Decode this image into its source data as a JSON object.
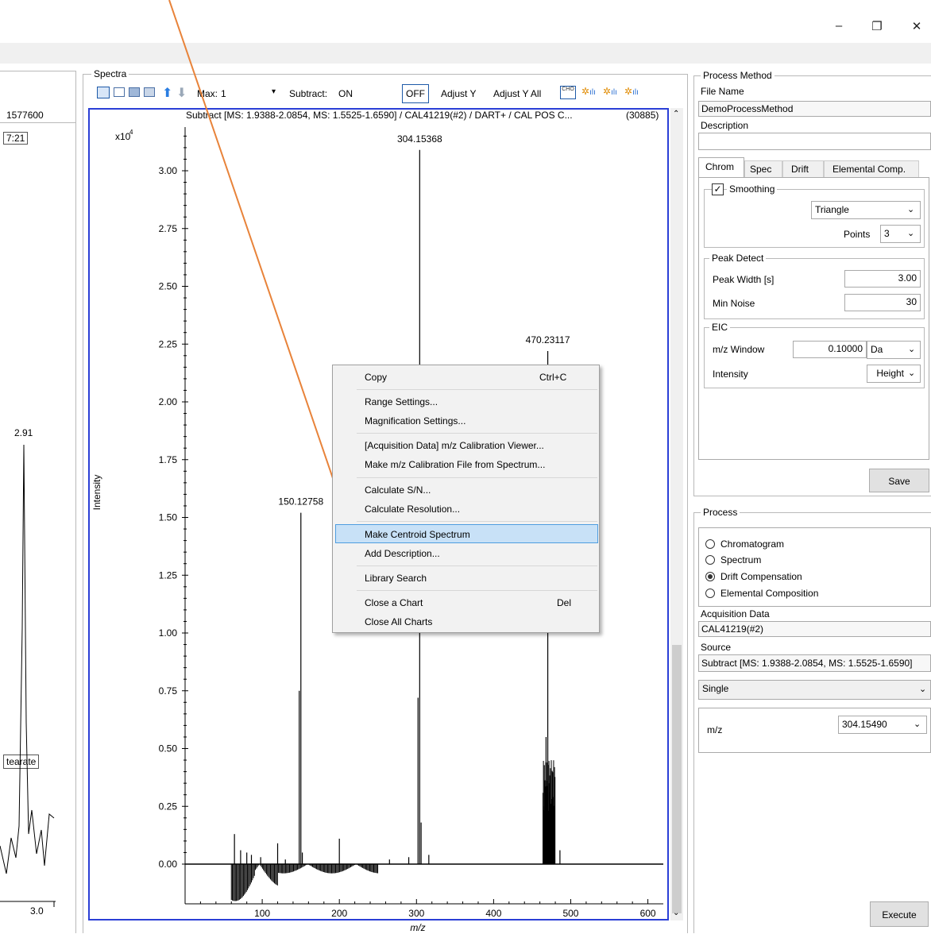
{
  "window": {
    "min": "–",
    "restore": "❐",
    "close": "✕"
  },
  "left": {
    "label_top": "1577600",
    "label_box": "7:21",
    "peak": "2.91",
    "stearate": "tearate",
    "x_tick": "3.0"
  },
  "spectra": {
    "title": "Spectra",
    "toolbar": {
      "max_label": "Max:",
      "max_value": "1",
      "subtract_label": "Subtract:",
      "on": "ON",
      "off": "OFF",
      "adjust_y": "Adjust Y",
      "adjust_y_all": "Adjust Y All"
    },
    "header": "Subtract [MS: 1.9388-2.0854, MS: 1.5525-1.6590] / CAL41219(#2) / DART+ / CAL POS C...",
    "count": "(30885)"
  },
  "chart_data": {
    "type": "line",
    "xlabel": "m/z",
    "ylabel": "Intensity",
    "y_exponent": "x10",
    "y_exponent_power": "4",
    "xlim": [
      0,
      620
    ],
    "ylim": [
      -0.12,
      3.26
    ],
    "x_ticks": [
      "100",
      "200",
      "300",
      "400",
      "500",
      "600"
    ],
    "x_tick_values": [
      100,
      200,
      300,
      400,
      500,
      600
    ],
    "y_ticks": [
      "3.00",
      "2.75",
      "2.50",
      "2.25",
      "2.00",
      "1.75",
      "1.50",
      "1.25",
      "1.00",
      "0.75",
      "0.50",
      "0.25",
      "0.00"
    ],
    "y_tick_values": [
      3.0,
      2.75,
      2.5,
      2.25,
      2.0,
      1.75,
      1.5,
      1.25,
      1.0,
      0.75,
      0.5,
      0.25,
      0.0
    ],
    "peaks": [
      {
        "mz": 64,
        "intensity": 0.13
      },
      {
        "mz": 72,
        "intensity": 0.06
      },
      {
        "mz": 80,
        "intensity": 0.05
      },
      {
        "mz": 86,
        "intensity": 0.04
      },
      {
        "mz": 98,
        "intensity": 0.03
      },
      {
        "mz": 120,
        "intensity": 0.09
      },
      {
        "mz": 130,
        "intensity": 0.02
      },
      {
        "mz": 148,
        "intensity": 0.75
      },
      {
        "mz": 150.12758,
        "intensity": 1.52
      },
      {
        "mz": 152,
        "intensity": 0.05
      },
      {
        "mz": 200,
        "intensity": 0.11
      },
      {
        "mz": 265,
        "intensity": 0.02
      },
      {
        "mz": 290,
        "intensity": 0.03
      },
      {
        "mz": 302,
        "intensity": 0.72
      },
      {
        "mz": 304.15368,
        "intensity": 3.09
      },
      {
        "mz": 306,
        "intensity": 0.18
      },
      {
        "mz": 316,
        "intensity": 0.04
      },
      {
        "mz": 466,
        "intensity": 0.25
      },
      {
        "mz": 468,
        "intensity": 0.55
      },
      {
        "mz": 470.23117,
        "intensity": 2.22
      },
      {
        "mz": 472,
        "intensity": 0.35
      },
      {
        "mz": 474,
        "intensity": 0.12
      },
      {
        "mz": 486,
        "intensity": 0.06
      }
    ],
    "labels": [
      {
        "mz": 304.15368,
        "text": "304.15368"
      },
      {
        "mz": 150.12758,
        "text": "150.12758"
      },
      {
        "mz": 470.23117,
        "text": "470.23117"
      }
    ]
  },
  "context_menu": {
    "items": [
      {
        "label": "Copy",
        "shortcut": "Ctrl+C"
      },
      {
        "label": "Range Settings..."
      },
      {
        "label": "Magnification Settings..."
      },
      {
        "label": "[Acquisition Data] m/z Calibration Viewer..."
      },
      {
        "label": "Make m/z Calibration File from Spectrum..."
      },
      {
        "label": "Calculate S/N..."
      },
      {
        "label": "Calculate Resolution..."
      },
      {
        "label": "Make Centroid Spectrum"
      },
      {
        "label": "Add Description..."
      },
      {
        "label": "Library Search"
      },
      {
        "label": "Close a Chart",
        "shortcut": "Del"
      },
      {
        "label": "Close All Charts"
      }
    ]
  },
  "process_method": {
    "title": "Process Method",
    "file_name_label": "File Name",
    "file_name": "DemoProcessMethod",
    "description_label": "Description",
    "description": "",
    "tabs": [
      "Chrom",
      "Spec",
      "Drift",
      "Elemental Comp."
    ],
    "smoothing_label": "Smoothing",
    "smoothing_type": "Triangle",
    "points_label": "Points",
    "points": "3",
    "peak_detect": "Peak Detect",
    "peak_width_label": "Peak Width [s]",
    "peak_width": "3.00",
    "min_noise_label": "Min Noise",
    "min_noise": "30",
    "eic": "EIC",
    "mz_window_label": "m/z Window",
    "mz_window": "0.10000",
    "mz_unit": "Da",
    "intensity_label": "Intensity",
    "intensity": "Height",
    "save": "Save"
  },
  "process": {
    "title": "Process",
    "options": [
      "Chromatogram",
      "Spectrum",
      "Drift Compensation",
      "Elemental Composition"
    ],
    "acq_label": "Acquisition Data",
    "acq": "CAL41219(#2)",
    "source_label": "Source",
    "source": "Subtract [MS: 1.9388-2.0854, MS: 1.5525-1.6590]",
    "mode": "Single",
    "mz_label": "m/z",
    "mz": "304.15490",
    "execute": "Execute"
  }
}
